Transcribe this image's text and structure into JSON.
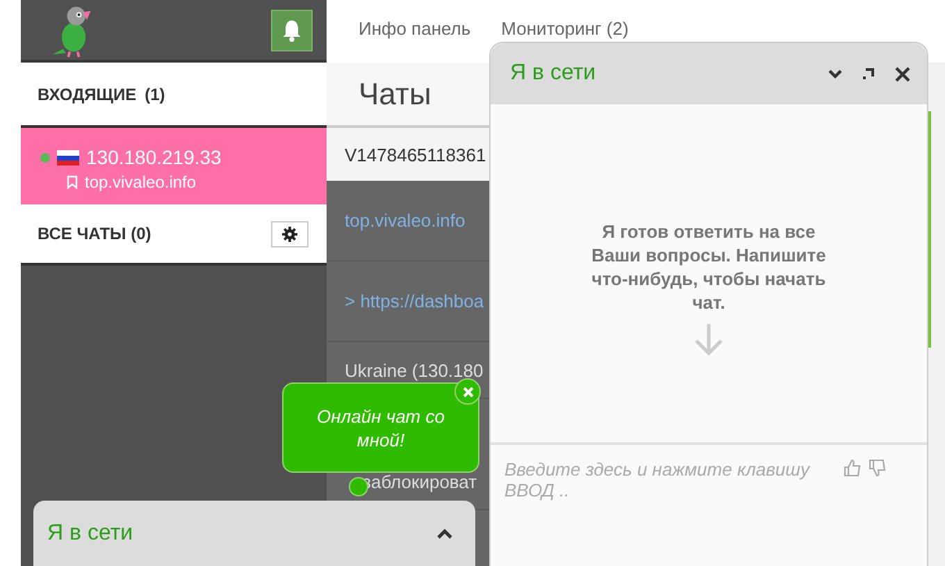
{
  "sidebar": {
    "incoming": {
      "label": "ВХОДЯЩИЕ",
      "count": "(1)"
    },
    "chats": [
      {
        "ip": "130.180.219.33",
        "site": "top.vivaleo.info",
        "online": true,
        "selected": true
      }
    ],
    "all_chats": {
      "label": "ВСЕ ЧАТЫ (0)"
    }
  },
  "tabs": [
    {
      "label": "Инфо панель"
    },
    {
      "label": "Мониторинг (2)"
    }
  ],
  "page_title": "Чаты",
  "visitor_rows": [
    {
      "kind": "id",
      "text": "V1478465118361"
    },
    {
      "kind": "link",
      "text": "top.vivaleo.info"
    },
    {
      "kind": "link",
      "text": "> https://dashboa"
    },
    {
      "kind": "plain",
      "text": "Ukraine (130.180"
    },
    {
      "kind": "action",
      "text": "заблокироват"
    }
  ],
  "chat_window": {
    "title": "Я в сети",
    "message": "Я готов ответить на все Ваши вопросы. Напишите что-нибудь, чтобы начать чат.",
    "placeholder": "Введите здесь и нажмите клавишу ВВОД .."
  },
  "bubble": {
    "text": "Онлайн чат со мной!"
  },
  "chat_bar": {
    "title": "Я в сети"
  }
}
